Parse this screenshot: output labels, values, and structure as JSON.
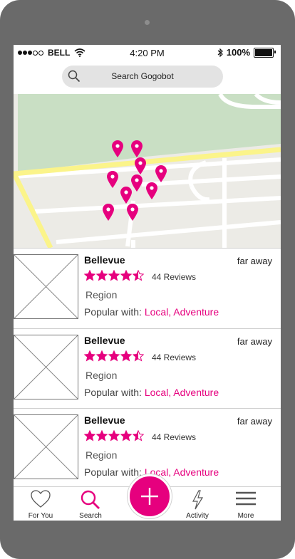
{
  "status": {
    "carrier": "BELL",
    "time": "4:20 PM",
    "battery": "100%"
  },
  "search": {
    "label": "Search Gogobot"
  },
  "map": {
    "pin_color": "#e6007e",
    "pin_count": 10
  },
  "listings": [
    {
      "name": "Bellevue",
      "distance": "far away",
      "rating": 4.5,
      "reviews": "44 Reviews",
      "region": "Region",
      "popular_label": "Popular with:",
      "popular_tags": "Local, Adventure"
    },
    {
      "name": "Bellevue",
      "distance": "far away",
      "rating": 4.5,
      "reviews": "44 Reviews",
      "region": "Region",
      "popular_label": "Popular with:",
      "popular_tags": "Local, Adventure"
    },
    {
      "name": "Bellevue",
      "distance": "far away",
      "rating": 4.5,
      "reviews": "44 Reviews",
      "region": "Region",
      "popular_label": "Popular with:",
      "popular_tags": "Local, Adventure"
    }
  ],
  "tabs": [
    {
      "label": "For You",
      "icon": "heart-icon"
    },
    {
      "label": "Search",
      "icon": "search-icon",
      "active": true
    },
    {
      "label": "Activity",
      "icon": "lightning-icon"
    },
    {
      "label": "More",
      "icon": "menu-icon"
    }
  ],
  "colors": {
    "accent": "#e6007e",
    "phone_frame": "#6a6a6a",
    "map_park": "#c9dfc4",
    "map_road_major": "#fbf48a"
  }
}
